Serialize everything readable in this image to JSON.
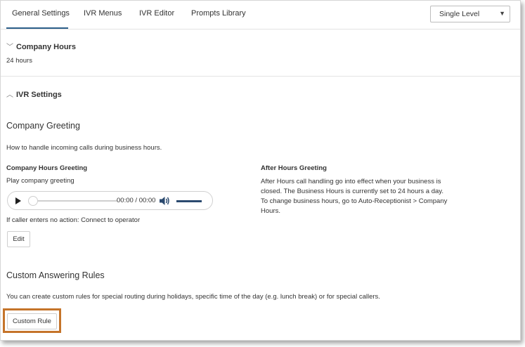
{
  "tabs": [
    {
      "label": "General Settings",
      "active": true
    },
    {
      "label": "IVR Menus",
      "active": false
    },
    {
      "label": "IVR Editor",
      "active": false
    },
    {
      "label": "Prompts Library",
      "active": false
    }
  ],
  "level_select": {
    "value": "Single Level",
    "icon": "caret-down-icon"
  },
  "company_hours": {
    "title": "Company Hours",
    "value": "24 hours",
    "icon": "chevron-down-icon"
  },
  "ivr_settings": {
    "title": "IVR Settings",
    "icon": "chevron-up-icon"
  },
  "company_greeting": {
    "title": "Company Greeting",
    "description": "How to handle incoming calls during business hours.",
    "hours_greeting_label": "Company Hours Greeting",
    "hours_greeting_value": "Play company greeting",
    "player": {
      "time": "00:00 / 00:00",
      "progress": 0,
      "volume": 0.85
    },
    "no_action_text": "If caller enters no action: Connect to operator",
    "edit_label": "Edit",
    "after_hours_label": "After Hours Greeting",
    "after_hours_lines": [
      "After Hours call handling go into effect when your business is",
      "closed. The Business Hours is currently set to 24 hours a day.",
      "To change business hours, go to Auto-Receptionist > Company",
      "Hours."
    ]
  },
  "custom_rules": {
    "title": "Custom Answering Rules",
    "description": "You can create custom rules for special routing during holidays, specific time of the day (e.g. lunch break) or for special callers.",
    "button_label": "Custom Rule"
  },
  "colors": {
    "accent": "#2d5f8a",
    "highlight": "#c5742a"
  }
}
